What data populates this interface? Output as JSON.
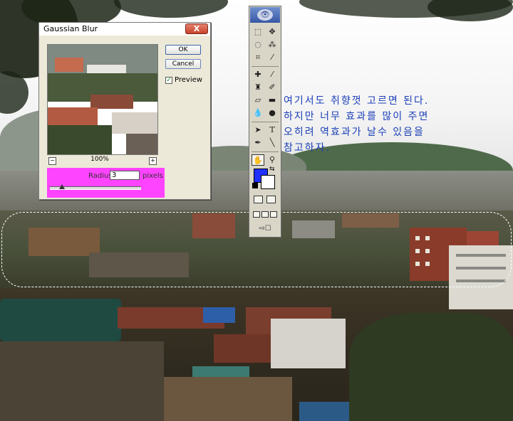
{
  "dialog": {
    "title": "Gaussian Blur",
    "close_label": "X",
    "ok_label": "OK",
    "cancel_label": "Cancel",
    "preview_label": "Preview",
    "preview_checked": true,
    "zoom_minus": "−",
    "zoom_plus": "+",
    "zoom_level": "100%",
    "radius_label": "Radius",
    "radius_value": "3",
    "radius_unit": "pixels",
    "radius_slider_level": 0.13
  },
  "toolbox": {
    "tools": [
      "marquee",
      "move",
      "lasso",
      "magic-wand",
      "crop",
      "slice",
      "healing-brush",
      "brush",
      "clone-stamp",
      "history-brush",
      "eraser",
      "gradient",
      "blur",
      "dodge",
      "path-selection",
      "type",
      "pen",
      "line",
      "notes",
      "eyedropper",
      "hand",
      "zoom"
    ],
    "glyphs": {
      "type": "T",
      "zoom": "🔍",
      "hand": "✋",
      "eyedropper": "✎"
    },
    "foreground_color": "#2030ff",
    "background_color": "#ffffff"
  },
  "note": {
    "lines": [
      "여기서도 취향껏 고르면 된다.",
      "하지만 너무 효과를 많이 주면",
      "오히려 역효과가 날수 있음을",
      "참고하자."
    ],
    "color": "#1a3fb8"
  },
  "colors": {
    "radius_panel": "#ff44ff",
    "dialog_face": "#ece9d8",
    "close_button": "#c8432b"
  }
}
